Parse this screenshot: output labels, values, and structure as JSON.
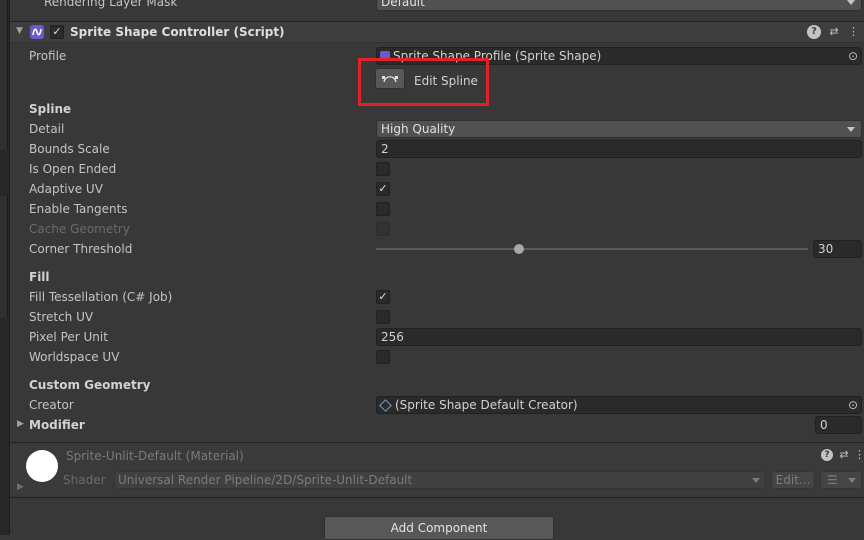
{
  "top": {
    "label": "Rendering Layer Mask",
    "value": "Default"
  },
  "component": {
    "title": "Sprite Shape Controller (Script)",
    "enabled": true
  },
  "profile": {
    "label": "Profile",
    "value": "Sprite Shape Profile (Sprite Shape)"
  },
  "edit_spline": {
    "label": "Edit Spline"
  },
  "spline": {
    "header": "Spline",
    "detail": {
      "label": "Detail",
      "value": "High Quality"
    },
    "bounds_scale": {
      "label": "Bounds Scale",
      "value": "2"
    },
    "is_open_ended": {
      "label": "Is Open Ended",
      "checked": false
    },
    "adaptive_uv": {
      "label": "Adaptive UV",
      "checked": true,
      "mark": "✓"
    },
    "enable_tangents": {
      "label": "Enable Tangents",
      "checked": false
    },
    "cache_geometry": {
      "label": "Cache Geometry",
      "checked": false,
      "disabled": true
    },
    "corner_threshold": {
      "label": "Corner Threshold",
      "value": "30",
      "slider_fraction": 0.33
    }
  },
  "fill": {
    "header": "Fill",
    "fill_tessellation": {
      "label": "Fill Tessellation (C# Job)",
      "checked": true,
      "mark": "✓"
    },
    "stretch_uv": {
      "label": "Stretch UV",
      "checked": false
    },
    "pixel_per_unit": {
      "label": "Pixel Per Unit",
      "value": "256"
    },
    "worldspace_uv": {
      "label": "Worldspace UV",
      "checked": false
    }
  },
  "custom_geometry": {
    "header": "Custom Geometry",
    "creator": {
      "label": "Creator",
      "value": "(Sprite Shape Default Creator)"
    },
    "modifier": {
      "label": "Modifier",
      "value": "0"
    }
  },
  "material": {
    "title": "Sprite-Unlit-Default (Material)",
    "shader_label": "Shader",
    "shader_value": "Universal Render Pipeline/2D/Sprite-Unlit-Default",
    "edit_label": "Edit..."
  },
  "add_component": {
    "label": "Add Component"
  },
  "icons": {
    "help": "?",
    "preset": "⇄",
    "menu": "⋮",
    "foldout_open": "▼",
    "foldout_closed": "▶",
    "check": "✓",
    "picker": "⊙",
    "list": "☰"
  },
  "colors": {
    "highlight": "#e0232b",
    "script_icon": "#6a5acd",
    "slider_thumb": "#a8a8a8"
  }
}
